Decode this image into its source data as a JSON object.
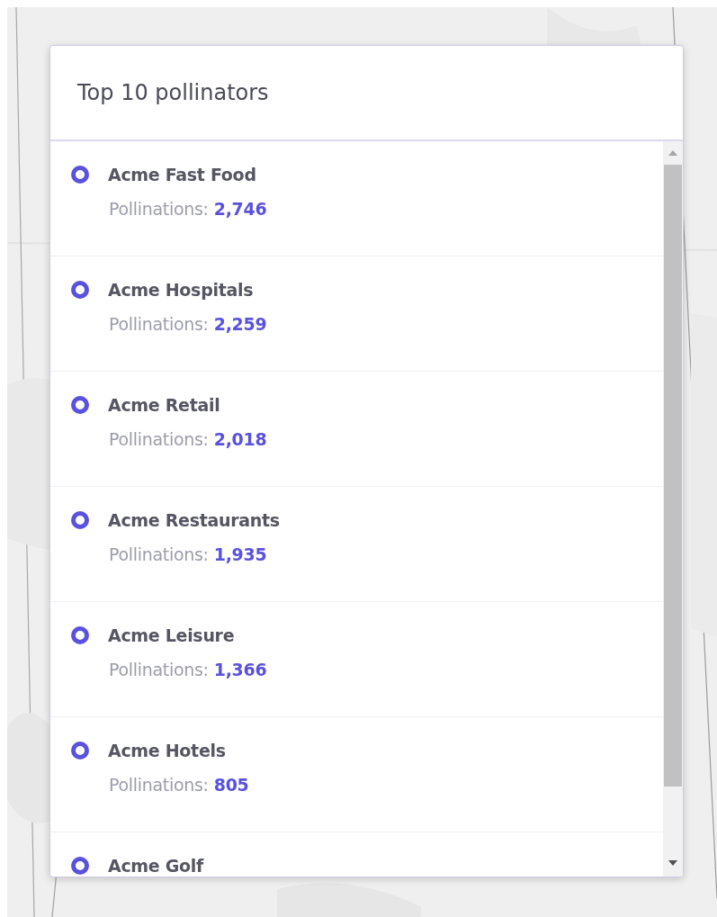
{
  "panel": {
    "title": "Top 10 pollinators"
  },
  "items": [
    {
      "name": "Acme Fast Food",
      "label": "Pollinations:",
      "count": "2,746"
    },
    {
      "name": "Acme Hospitals",
      "label": "Pollinations:",
      "count": "2,259"
    },
    {
      "name": "Acme Retail",
      "label": "Pollinations:",
      "count": "2,018"
    },
    {
      "name": "Acme Restaurants",
      "label": "Pollinations:",
      "count": "1,935"
    },
    {
      "name": "Acme Leisure",
      "label": "Pollinations:",
      "count": "1,366"
    },
    {
      "name": "Acme Hotels",
      "label": "Pollinations:",
      "count": "805"
    },
    {
      "name": "Acme Golf"
    }
  ]
}
